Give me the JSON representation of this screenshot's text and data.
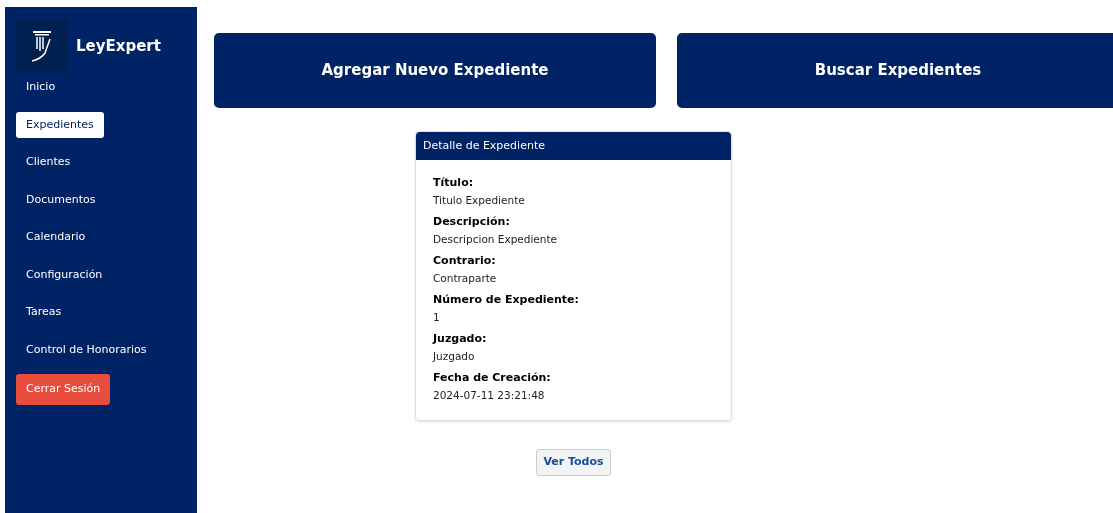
{
  "sidebar": {
    "brand": "LeyExpert",
    "items": [
      {
        "label": "Inicio",
        "selected": false
      },
      {
        "label": "Expedientes",
        "selected": true
      },
      {
        "label": "Clientes",
        "selected": false
      },
      {
        "label": "Documentos",
        "selected": false
      },
      {
        "label": "Calendario",
        "selected": false
      },
      {
        "label": "Configuración",
        "selected": false
      },
      {
        "label": "Tareas",
        "selected": false
      },
      {
        "label": "Control de Honorarios",
        "selected": false
      }
    ],
    "logout_button": "Cerrar Sesión"
  },
  "actions": [
    "Agregar Nuevo Expediente",
    "Buscar Expedientes"
  ],
  "detail_card": {
    "title": "Detalle de Expediente",
    "fields": [
      {
        "label": "Título:",
        "value": "Titulo Expediente"
      },
      {
        "label": "Descripción:",
        "value": "Descripcion Expediente"
      },
      {
        "label": "Contrario:",
        "value": "Contraparte"
      },
      {
        "label": "Número de Expediente:",
        "value": "1"
      },
      {
        "label": "Juzgado:",
        "value": "Juzgado"
      },
      {
        "label": "Fecha de Creación:",
        "value": "2024-07-11 23:21:48"
      }
    ]
  },
  "view_all_button": "Ver Todos"
}
